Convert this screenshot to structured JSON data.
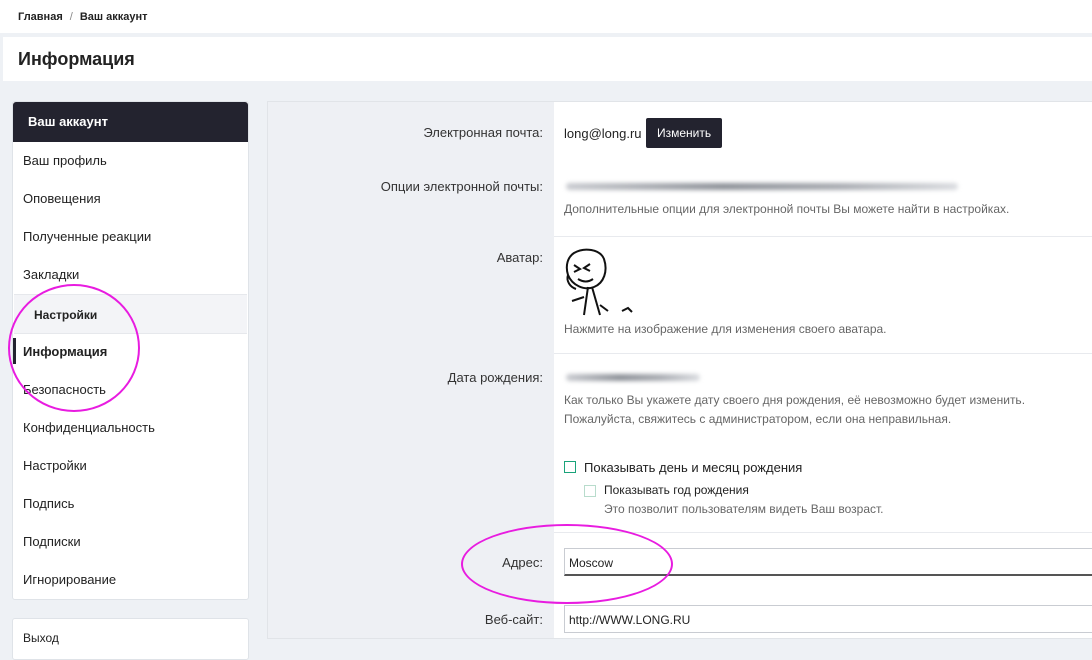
{
  "breadcrumb": {
    "home": "Главная",
    "separator": "/",
    "current": "Ваш аккаунт"
  },
  "page": {
    "title": "Информация"
  },
  "sidebar": {
    "header": "Ваш аккаунт",
    "items": [
      {
        "label": "Ваш профиль"
      },
      {
        "label": "Оповещения"
      },
      {
        "label": "Полученные реакции"
      },
      {
        "label": "Закладки"
      }
    ],
    "section": "Настройки",
    "settings_items": [
      {
        "label": "Информация",
        "active": true
      },
      {
        "label": "Безопасность"
      },
      {
        "label": "Конфиденциальность"
      },
      {
        "label": "Настройки"
      },
      {
        "label": "Подпись"
      },
      {
        "label": "Подписки"
      },
      {
        "label": "Игнорирование"
      }
    ],
    "footer_item": "Выход"
  },
  "form": {
    "email_label": "Электронная почта:",
    "email_value": "long@long.ru",
    "email_change_button": "Изменить",
    "email_options_label": "Опции электронной почты:",
    "email_options_hint": "Дополнительные опции для электронной почты Вы можете найти в настройках.",
    "avatar_label": "Аватар:",
    "avatar_hint": "Нажмите на изображение для изменения своего аватара.",
    "birthdate_label": "Дата рождения:",
    "birthdate_hint_1": "Как только Вы укажете дату своего дня рождения, её невозможно будет изменить.",
    "birthdate_hint_2": "Пожалуйста, свяжитесь с администратором, если она неправильная.",
    "show_day_month_label": "Показывать день и месяц рождения",
    "show_year_label": "Показывать год рождения",
    "show_year_hint": "Это позволит пользователям видеть Ваш возраст.",
    "address_label": "Адрес:",
    "address_value": "Moscow",
    "website_label": "Веб-сайт:",
    "website_value": "http://WWW.LONG.RU"
  },
  "colors": {
    "accent_dark": "#23232f",
    "highlight_circle": "#e81ce0",
    "checkbox": "#1aa37a"
  }
}
